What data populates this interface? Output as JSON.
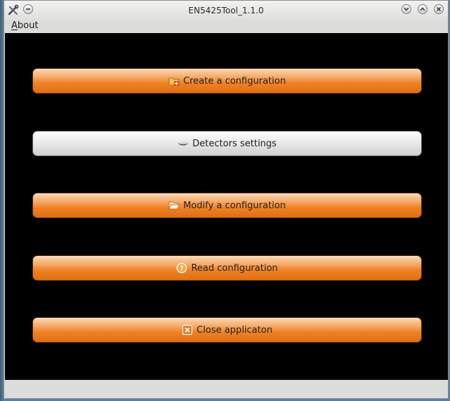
{
  "window": {
    "title": "EN5425Tool_1.1.0"
  },
  "menubar": {
    "about_first": "A",
    "about_rest": "bout"
  },
  "buttons": [
    {
      "label": "Create a configuration",
      "icon": "folder-new-icon"
    },
    {
      "label": "Detectors settings",
      "icon": "detector-icon"
    },
    {
      "label": "Modify a configuration",
      "icon": "folder-open-icon"
    },
    {
      "label": "Read configuration",
      "icon": "question-icon"
    },
    {
      "label": "Close applicaton",
      "icon": "close-x-icon"
    }
  ],
  "colors": {
    "accent": "#ee8124",
    "selected": "#e4e4e4",
    "background": "#000000"
  }
}
